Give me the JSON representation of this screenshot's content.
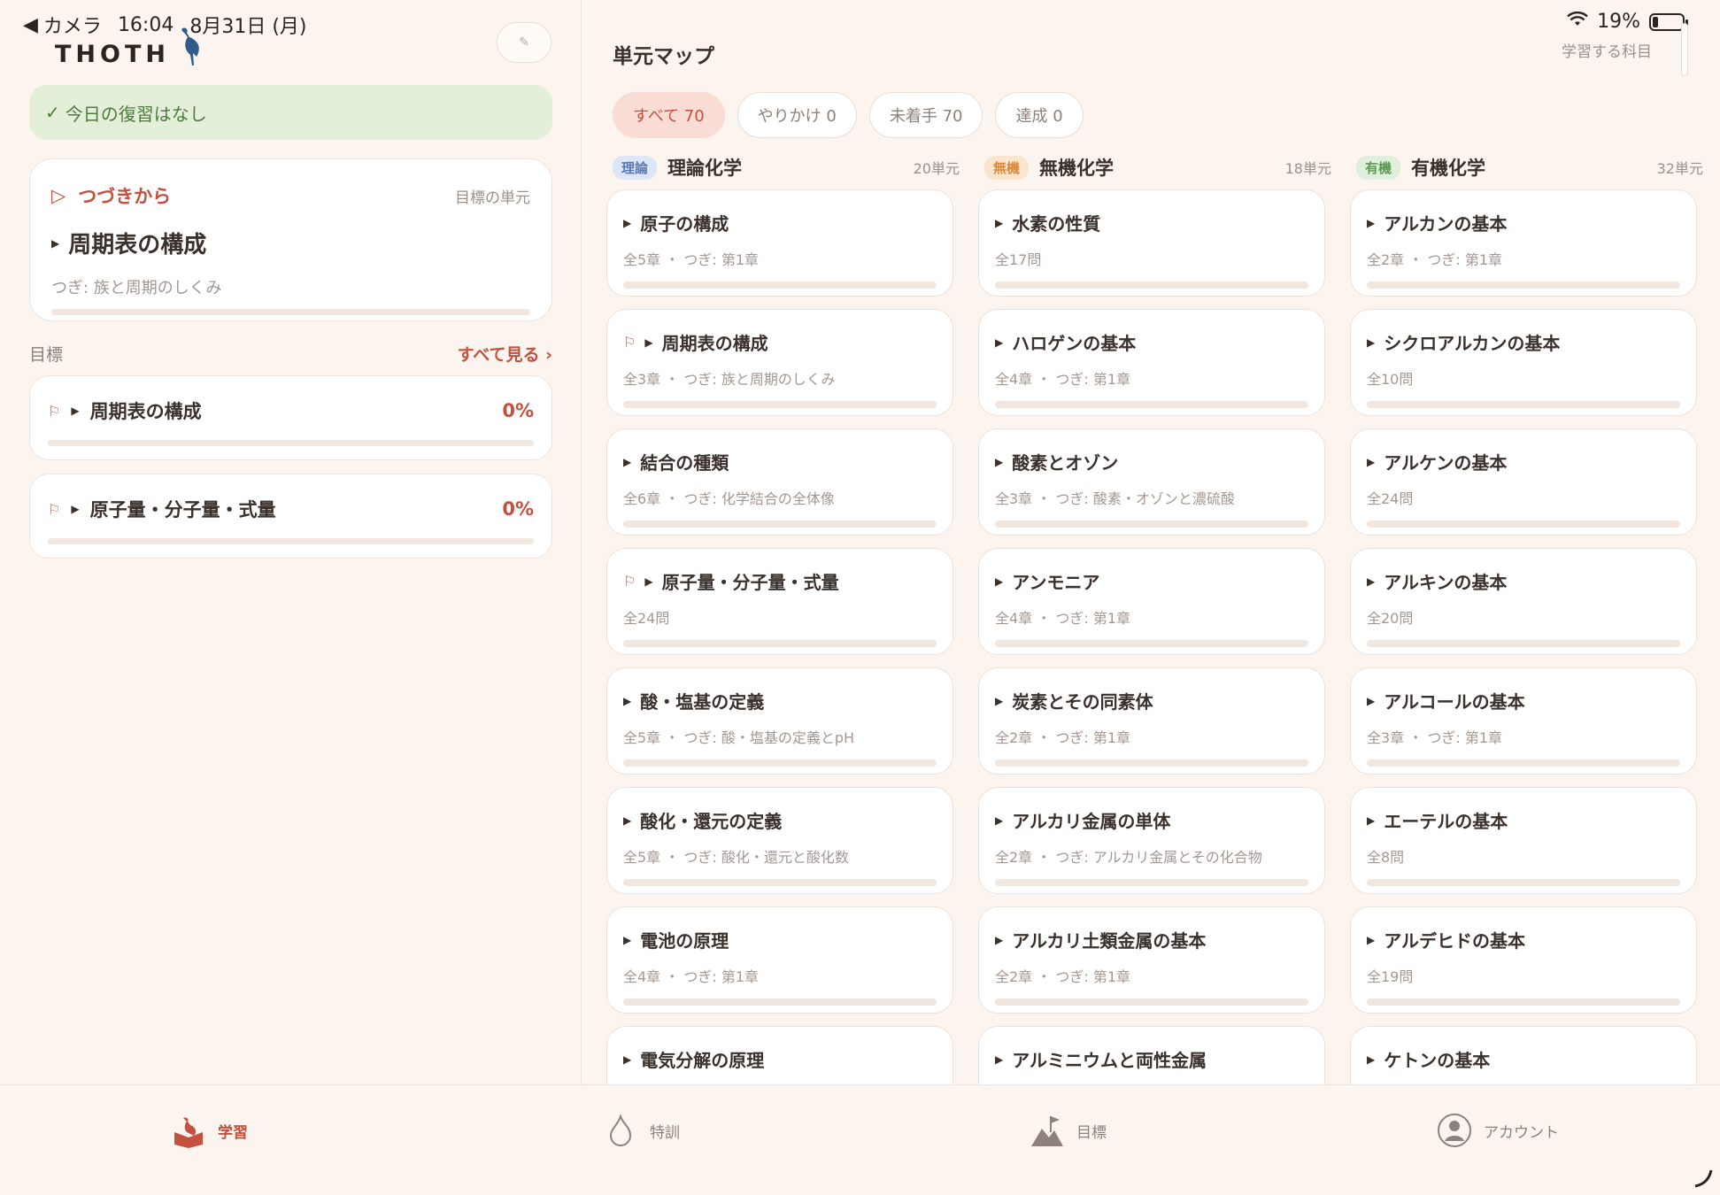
{
  "status_bar": {
    "back_app": "カメラ",
    "time": "16:04",
    "date": "8月31日 (月)",
    "battery": "19%",
    "battery_level": 0.19
  },
  "app": {
    "logo": "THOTH"
  },
  "review": {
    "text": "今日の復習はなし"
  },
  "continue": {
    "label": "つづきから",
    "target_label": "目標の単元",
    "title": "周期表の構成",
    "next": "つぎ: 族と周期のしくみ",
    "progress": 0
  },
  "goals": {
    "heading": "目標",
    "see_all": "すべて見る ›",
    "items": [
      {
        "name": "周期表の構成",
        "percent": "0%",
        "progress": 0
      },
      {
        "name": "原子量・分子量・式量",
        "percent": "0%",
        "progress": 0
      }
    ]
  },
  "map": {
    "title": "単元マップ",
    "subject_label": "学習する科目",
    "filters": [
      {
        "label": "すべて 70",
        "active": true
      },
      {
        "label": "やりかけ 0",
        "active": false
      },
      {
        "label": "未着手 70",
        "active": false
      },
      {
        "label": "達成 0",
        "active": false
      }
    ],
    "columns": [
      {
        "tag": "理論",
        "name": "理論化学",
        "count": "20単元",
        "units": [
          {
            "title": "原子の構成",
            "sub": "全5章 ・ つぎ: 第1章",
            "flag": false
          },
          {
            "title": "周期表の構成",
            "sub": "全3章 ・ つぎ: 族と周期のしくみ",
            "flag": true
          },
          {
            "title": "結合の種類",
            "sub": "全6章 ・ つぎ: 化学結合の全体像",
            "flag": false
          },
          {
            "title": "原子量・分子量・式量",
            "sub": "全24問",
            "flag": true
          },
          {
            "title": "酸・塩基の定義",
            "sub": "全5章 ・ つぎ: 酸・塩基の定義とpH",
            "flag": false
          },
          {
            "title": "酸化・還元の定義",
            "sub": "全5章 ・ つぎ: 酸化・還元と酸化数",
            "flag": false
          },
          {
            "title": "電池の原理",
            "sub": "全4章 ・ つぎ: 第1章",
            "flag": false
          },
          {
            "title": "電気分解の原理",
            "sub": "",
            "flag": false
          }
        ]
      },
      {
        "tag": "無機",
        "name": "無機化学",
        "count": "18単元",
        "units": [
          {
            "title": "水素の性質",
            "sub": "全17問",
            "flag": false
          },
          {
            "title": "ハロゲンの基本",
            "sub": "全4章 ・ つぎ: 第1章",
            "flag": false
          },
          {
            "title": "酸素とオゾン",
            "sub": "全3章 ・ つぎ: 酸素・オゾンと濃硫酸",
            "flag": false
          },
          {
            "title": "アンモニア",
            "sub": "全4章 ・ つぎ: 第1章",
            "flag": false
          },
          {
            "title": "炭素とその同素体",
            "sub": "全2章 ・ つぎ: 第1章",
            "flag": false
          },
          {
            "title": "アルカリ金属の単体",
            "sub": "全2章 ・ つぎ: アルカリ金属とその化合物",
            "flag": false
          },
          {
            "title": "アルカリ土類金属の基本",
            "sub": "全2章 ・ つぎ: 第1章",
            "flag": false
          },
          {
            "title": "アルミニウムと両性金属",
            "sub": "",
            "flag": false
          }
        ]
      },
      {
        "tag": "有機",
        "name": "有機化学",
        "count": "32単元",
        "units": [
          {
            "title": "アルカンの基本",
            "sub": "全2章 ・ つぎ: 第1章",
            "flag": false
          },
          {
            "title": "シクロアルカンの基本",
            "sub": "全10問",
            "flag": false
          },
          {
            "title": "アルケンの基本",
            "sub": "全24問",
            "flag": false
          },
          {
            "title": "アルキンの基本",
            "sub": "全20問",
            "flag": false
          },
          {
            "title": "アルコールの基本",
            "sub": "全3章 ・ つぎ: 第1章",
            "flag": false
          },
          {
            "title": "エーテルの基本",
            "sub": "全8問",
            "flag": false
          },
          {
            "title": "アルデヒドの基本",
            "sub": "全19問",
            "flag": false
          },
          {
            "title": "ケトンの基本",
            "sub": "",
            "flag": false
          }
        ]
      }
    ]
  },
  "tabs": [
    {
      "label": "学習",
      "icon": "study-icon",
      "active": true
    },
    {
      "label": "特訓",
      "icon": "flame-icon",
      "active": false
    },
    {
      "label": "目標",
      "icon": "goal-flag-icon",
      "active": false
    },
    {
      "label": "アカウント",
      "icon": "account-icon",
      "active": false
    }
  ],
  "colors": {
    "accent": "#c4503f",
    "background": "#fcf4ee",
    "review_bg": "#e4efd9",
    "review_text": "#4f7a3e"
  }
}
